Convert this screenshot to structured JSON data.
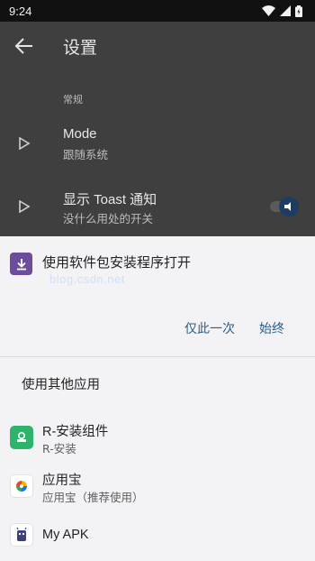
{
  "status_bar": {
    "time": "9:24",
    "icons": [
      "wifi-icon",
      "signal-icon",
      "battery-icon"
    ]
  },
  "settings": {
    "title": "设置",
    "section_label": "常规",
    "rows": [
      {
        "title": "Mode",
        "subtitle": "跟随系统"
      },
      {
        "title": "显示 Toast 通知",
        "subtitle": "没什么用处的开关",
        "toggle_on": true
      }
    ]
  },
  "sheet": {
    "title": "使用软件包安装程序打开",
    "watermark": "blog.csdn.net",
    "actions": {
      "just_once": "仅此一次",
      "always": "始终"
    },
    "other_apps_title": "使用其他应用",
    "apps": [
      {
        "name": "R-安装组件",
        "subtitle": "R-安装"
      },
      {
        "name": "应用宝",
        "subtitle": "应用宝（推荐使用）"
      },
      {
        "name": "My APK",
        "subtitle": ""
      }
    ]
  },
  "colors": {
    "accent": "#2a5e8a",
    "sheet_bg": "#f3f3f5",
    "installer_icon": "#6b4d9b"
  }
}
